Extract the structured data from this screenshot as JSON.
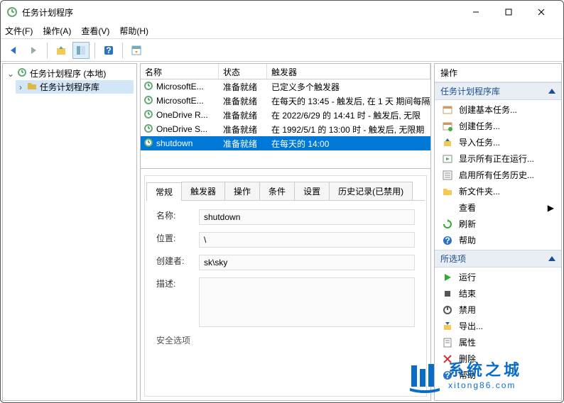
{
  "window": {
    "title": "任务计划程序"
  },
  "menu": {
    "file": "文件(F)",
    "action": "操作(A)",
    "view": "查看(V)",
    "help": "帮助(H)"
  },
  "tree": {
    "root": "任务计划程序 (本地)",
    "library": "任务计划程序库"
  },
  "grid": {
    "headers": {
      "name": "名称",
      "status": "状态",
      "trigger": "触发器"
    },
    "rows": [
      {
        "name": "MicrosoftE...",
        "status": "准备就绪",
        "trigger": "已定义多个触发器"
      },
      {
        "name": "MicrosoftE...",
        "status": "准备就绪",
        "trigger": "在每天的 13:45 - 触发后, 在 1 天 期间每隔"
      },
      {
        "name": "OneDrive R...",
        "status": "准备就绪",
        "trigger": "在 2022/6/29 的 14:41 时 - 触发后, 无限"
      },
      {
        "name": "OneDrive S...",
        "status": "准备就绪",
        "trigger": "在 1992/5/1 的 13:00 时 - 触发后, 无限期"
      },
      {
        "name": "shutdown",
        "status": "准备就绪",
        "trigger": "在每天的 14:00"
      }
    ]
  },
  "tabs": {
    "general": "常规",
    "triggers": "触发器",
    "operations": "操作",
    "conditions": "条件",
    "settings": "设置",
    "history": "历史记录(已禁用)"
  },
  "detail": {
    "name_label": "名称:",
    "name_value": "shutdown",
    "location_label": "位置:",
    "location_value": "\\",
    "creator_label": "创建者:",
    "creator_value": "sk\\sky",
    "desc_label": "描述:",
    "security_label": "安全选项"
  },
  "actions": {
    "header": "操作",
    "section_library": "任务计划程序库",
    "items_library": [
      {
        "k": "create-basic",
        "label": "创建基本任务..."
      },
      {
        "k": "create-task",
        "label": "创建任务..."
      },
      {
        "k": "import",
        "label": "导入任务..."
      },
      {
        "k": "show-running",
        "label": "显示所有正在运行..."
      },
      {
        "k": "enable-history",
        "label": "启用所有任务历史..."
      },
      {
        "k": "new-folder",
        "label": "新文件夹..."
      },
      {
        "k": "view",
        "label": "查看",
        "chevron": true
      },
      {
        "k": "refresh",
        "label": "刷新"
      },
      {
        "k": "help",
        "label": "帮助"
      }
    ],
    "section_selected": "所选项",
    "items_selected": [
      {
        "k": "run",
        "label": "运行"
      },
      {
        "k": "end",
        "label": "结束"
      },
      {
        "k": "disable",
        "label": "禁用"
      },
      {
        "k": "export",
        "label": "导出..."
      },
      {
        "k": "properties",
        "label": "属性"
      },
      {
        "k": "delete",
        "label": "删除"
      },
      {
        "k": "help2",
        "label": "帮助"
      }
    ]
  },
  "watermark": {
    "text_big": "系统之城",
    "text_small": "xitong86.com"
  }
}
